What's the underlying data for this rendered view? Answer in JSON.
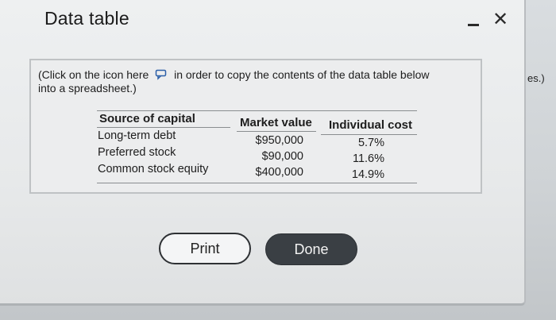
{
  "dialog": {
    "title": "Data table",
    "close_glyph": "✕",
    "background_text": "es.)"
  },
  "instructions": {
    "before_icon": "(Click on the icon  here",
    "icon": "copy-icon",
    "after_icon": "in order to copy the contents of the data table below",
    "line2": "into a spreadsheet.)"
  },
  "table": {
    "headers": [
      "Source of capital",
      "Market value",
      "Individual cost"
    ],
    "rows": [
      {
        "source": "Long-term debt",
        "market_value": "$950,000",
        "cost": "5.7%"
      },
      {
        "source": "Preferred stock",
        "market_value": "$90,000",
        "cost": "11.6%"
      },
      {
        "source": "Common stock equity",
        "market_value": "$400,000",
        "cost": "14.9%"
      }
    ]
  },
  "buttons": {
    "print": "Print",
    "done": "Done"
  },
  "colors": {
    "done_button_bg": "#3a3f44",
    "dialog_bg": "#eef0f1"
  }
}
